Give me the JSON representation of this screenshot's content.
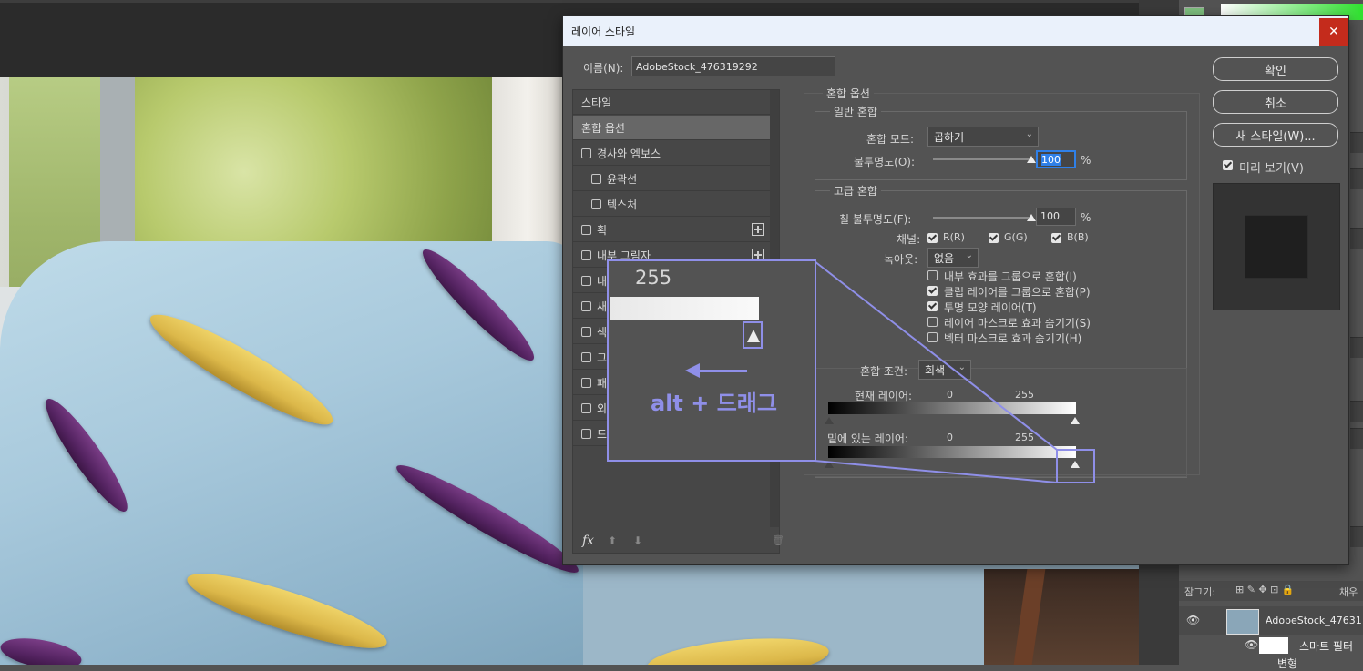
{
  "dialog": {
    "title": "레이어 스타일",
    "close": "✕",
    "name_label": "이름(N):",
    "name_value": "AdobeStock_476319292",
    "ok": "확인",
    "cancel": "취소",
    "new_style": "새 스타일(W)...",
    "preview": "미리 보기(V)",
    "preview_checked": true
  },
  "styles_list": [
    {
      "label": "스타일",
      "checkbox": false,
      "plus": false
    },
    {
      "label": "혼합 옵션",
      "checkbox": false,
      "plus": false,
      "selected": true
    },
    {
      "label": "경사와 엠보스",
      "checkbox": true,
      "plus": false
    },
    {
      "label": "윤곽선",
      "checkbox": true,
      "plus": false,
      "indent": true
    },
    {
      "label": "텍스처",
      "checkbox": true,
      "plus": false,
      "indent": true
    },
    {
      "label": "획",
      "checkbox": true,
      "plus": true
    },
    {
      "label": "내부 그림자",
      "checkbox": true,
      "plus": true
    },
    {
      "label": "내",
      "checkbox": true,
      "plus": false
    },
    {
      "label": "새",
      "checkbox": true,
      "plus": false
    },
    {
      "label": "색",
      "checkbox": true,
      "plus": false
    },
    {
      "label": "그",
      "checkbox": true,
      "plus": false
    },
    {
      "label": "패",
      "checkbox": true,
      "plus": false
    },
    {
      "label": "외",
      "checkbox": true,
      "plus": false
    },
    {
      "label": "드",
      "checkbox": true,
      "plus": false
    }
  ],
  "list_footer": {
    "fx": "fx",
    "up": "⬆",
    "down": "⬇",
    "trash": "🗑"
  },
  "blend_options": {
    "section_title": "혼합 옵션",
    "general": {
      "title": "일반 혼합",
      "mode_label": "혼합 모드:",
      "mode_value": "곱하기",
      "opacity_label": "불투명도(O):",
      "opacity_value": "100",
      "opacity_unit": "%",
      "opacity_level": 1.0
    },
    "advanced": {
      "title": "고급 혼합",
      "fill_label": "칠 불투명도(F):",
      "fill_value": "100",
      "fill_unit": "%",
      "fill_level": 1.0,
      "channels_label": "채널:",
      "channel_r": "R(R)",
      "channel_g": "G(G)",
      "channel_b": "B(B)",
      "knockout_label": "녹아웃:",
      "knockout_value": "없음",
      "options": [
        {
          "label": "내부 효과를 그룹으로 혼합(I)",
          "checked": false
        },
        {
          "label": "클립 레이어를 그룹으로 혼합(P)",
          "checked": true
        },
        {
          "label": "투명 모양 레이어(T)",
          "checked": true
        },
        {
          "label": "레이어 마스크로 효과 숨기기(S)",
          "checked": false
        },
        {
          "label": "벡터 마스크로 효과 숨기기(H)",
          "checked": false
        }
      ]
    },
    "blend_if": {
      "label": "혼합 조건:",
      "value": "회색",
      "current_layer": "현재 레이어:",
      "underlying_layer": "밑에 있는 레이어:",
      "min": "0",
      "max": "255"
    }
  },
  "annotation": {
    "zoom_value": "255",
    "hint": "alt + 드래그"
  },
  "right_panel": {
    "lock_label": "잠그기:",
    "fill_label": "채우",
    "layer_name": "AdobeStock_47631",
    "smart_filter": "스마트 필터",
    "sub_label": "변형"
  },
  "colors": {
    "accent": "#8f8fe8",
    "dialog_bg": "#535353",
    "close_red": "#c42b1c"
  }
}
